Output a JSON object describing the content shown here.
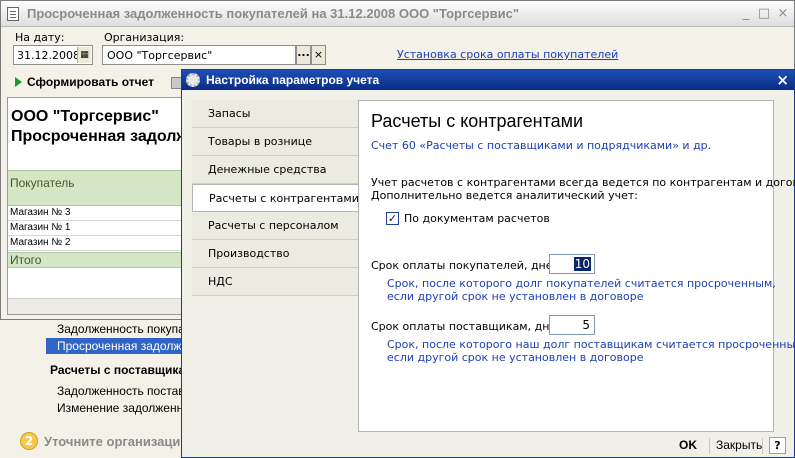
{
  "main_window": {
    "title": "Просроченная задолженность покупателей на 31.12.2008 ООО \"Торгсервис\"",
    "controls": {
      "minimize": "_",
      "maximize": "□",
      "close": "×"
    },
    "date_label": "На дату:",
    "date_value": "31.12.2008",
    "org_label": "Организация:",
    "org_value": "ООО \"Торгсервис\"",
    "org_select": "...",
    "org_clear": "×",
    "payment_term_link": "Установка срока оплаты покупателей",
    "generate_button": "Сформировать отчет",
    "report": {
      "org": "ООО \"Торгсервис\"",
      "title": "Просроченная задолженность",
      "column_header": "Покупатель",
      "rows": [
        "Магазин № 3",
        "Магазин № 1",
        "Магазин № 2"
      ],
      "total_label": "Итого"
    }
  },
  "task_panel": {
    "items": [
      "Задолженность покупателей",
      "Просроченная задолженность",
      "Расчеты с поставщиками",
      "Задолженность поставщикам",
      "Изменение задолженности"
    ],
    "step_number": "2",
    "step_label": "Уточните организацию"
  },
  "dialog": {
    "title": "Настройка параметров учета",
    "close": "×",
    "nav_items": [
      "Запасы",
      "Товары в рознице",
      "Денежные средства",
      "Расчеты с контрагентами",
      "Расчеты с персоналом",
      "Производство",
      "НДС"
    ],
    "active_nav_index": 3,
    "content": {
      "heading": "Расчеты с контрагентами",
      "account_note": "Счет 60 «Расчеты с поставщиками и подрядчиками» и др.",
      "desc_line1": "Учет расчетов с контрагентами всегда ведется по контрагентам и договорам.",
      "desc_line2": "Дополнительно ведется аналитический учет:",
      "checkbox_label": "По документам расчетов",
      "checkbox_mark": "✓",
      "checkbox_checked": true,
      "buyer_days_label": "Срок оплаты покупателей, дней:",
      "buyer_days_value": "10",
      "buyer_hint_1": "Срок, после которого долг покупателей считается просроченным,",
      "buyer_hint_2": "если другой срок не установлен в договоре",
      "supplier_days_label": "Срок оплаты поставщикам, дней:",
      "supplier_days_value": "5",
      "supplier_hint_1": "Срок, после которого наш долг поставщикам считается просроченным,",
      "supplier_hint_2": "если другой срок не установлен в договоре"
    },
    "footer": {
      "ok": "OK",
      "close": "Закрыть",
      "help": "?"
    }
  },
  "colors": {
    "dialog_titlebar": "#0a2c84",
    "link": "#1c3fb5",
    "report_header": "#d4e6c6",
    "selection": "#3165c5"
  }
}
